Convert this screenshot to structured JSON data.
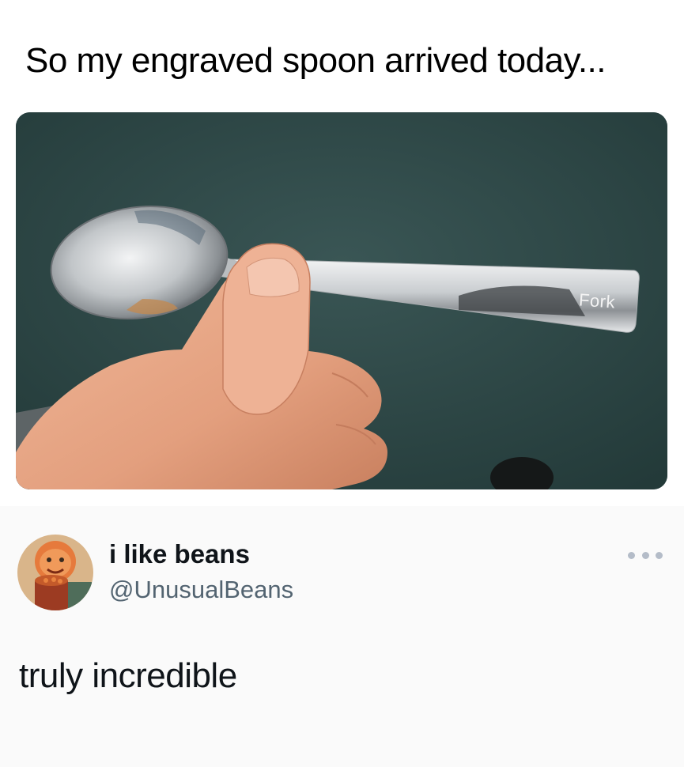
{
  "post": {
    "caption": "So my engraved spoon arrived today...",
    "image": {
      "engraving_text": "Fork",
      "colors": {
        "carpet": "#2f4a49",
        "skin": "#e6a27f",
        "steel": "#d9dde0"
      }
    }
  },
  "reply": {
    "author": {
      "display_name": "i like beans",
      "handle": "@UnusualBeans",
      "avatar_icon": "bean-eater-avatar"
    },
    "more_icon": "more-options-icon",
    "text": "truly incredible",
    "colors": {
      "name": "#0f1419",
      "handle": "#536471",
      "dots": "#b4bcc8"
    }
  }
}
